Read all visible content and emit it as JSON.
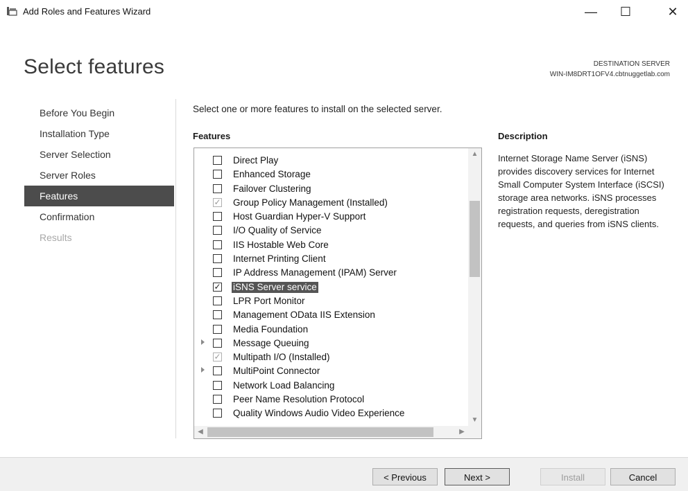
{
  "window": {
    "title": "Add Roles and Features Wizard",
    "controls": {
      "minimize": "—",
      "maximize": "☐",
      "close": "✕"
    }
  },
  "header": {
    "page_title": "Select features",
    "destination_label": "DESTINATION SERVER",
    "destination_server": "WIN-IM8DRT1OFV4.cbtnuggetlab.com"
  },
  "nav": {
    "items": [
      {
        "label": "Before You Begin",
        "state": "normal"
      },
      {
        "label": "Installation Type",
        "state": "normal"
      },
      {
        "label": "Server Selection",
        "state": "normal"
      },
      {
        "label": "Server Roles",
        "state": "normal"
      },
      {
        "label": "Features",
        "state": "active"
      },
      {
        "label": "Confirmation",
        "state": "normal"
      },
      {
        "label": "Results",
        "state": "disabled"
      }
    ]
  },
  "main": {
    "instruction": "Select one or more features to install on the selected server.",
    "features_heading": "Features",
    "features": [
      {
        "label": "Direct Play",
        "checked": false,
        "installed": false,
        "expandable": false,
        "selected": false
      },
      {
        "label": "Enhanced Storage",
        "checked": false,
        "installed": false,
        "expandable": false,
        "selected": false
      },
      {
        "label": "Failover Clustering",
        "checked": false,
        "installed": false,
        "expandable": false,
        "selected": false
      },
      {
        "label": "Group Policy Management (Installed)",
        "checked": true,
        "installed": true,
        "expandable": false,
        "selected": false
      },
      {
        "label": "Host Guardian Hyper-V Support",
        "checked": false,
        "installed": false,
        "expandable": false,
        "selected": false
      },
      {
        "label": "I/O Quality of Service",
        "checked": false,
        "installed": false,
        "expandable": false,
        "selected": false
      },
      {
        "label": "IIS Hostable Web Core",
        "checked": false,
        "installed": false,
        "expandable": false,
        "selected": false
      },
      {
        "label": "Internet Printing Client",
        "checked": false,
        "installed": false,
        "expandable": false,
        "selected": false
      },
      {
        "label": "IP Address Management (IPAM) Server",
        "checked": false,
        "installed": false,
        "expandable": false,
        "selected": false
      },
      {
        "label": "iSNS Server service",
        "checked": true,
        "installed": false,
        "expandable": false,
        "selected": true
      },
      {
        "label": "LPR Port Monitor",
        "checked": false,
        "installed": false,
        "expandable": false,
        "selected": false
      },
      {
        "label": "Management OData IIS Extension",
        "checked": false,
        "installed": false,
        "expandable": false,
        "selected": false
      },
      {
        "label": "Media Foundation",
        "checked": false,
        "installed": false,
        "expandable": false,
        "selected": false
      },
      {
        "label": "Message Queuing",
        "checked": false,
        "installed": false,
        "expandable": true,
        "selected": false
      },
      {
        "label": "Multipath I/O (Installed)",
        "checked": true,
        "installed": true,
        "expandable": false,
        "selected": false
      },
      {
        "label": "MultiPoint Connector",
        "checked": false,
        "installed": false,
        "expandable": true,
        "selected": false
      },
      {
        "label": "Network Load Balancing",
        "checked": false,
        "installed": false,
        "expandable": false,
        "selected": false
      },
      {
        "label": "Peer Name Resolution Protocol",
        "checked": false,
        "installed": false,
        "expandable": false,
        "selected": false
      },
      {
        "label": "Quality Windows Audio Video Experience",
        "checked": false,
        "installed": false,
        "expandable": false,
        "selected": false
      }
    ],
    "scroll_icons": {
      "up": "▲",
      "down": "▼",
      "left": "◀",
      "right": "▶"
    },
    "description_heading": "Description",
    "description_text": "Internet Storage Name Server (iSNS) provides discovery services for Internet Small Computer System Interface (iSCSI) storage area networks. iSNS processes registration requests, deregistration requests, and queries from iSNS clients."
  },
  "footer": {
    "previous_label": "< Previous",
    "next_label": "Next >",
    "install_label": "Install",
    "cancel_label": "Cancel"
  }
}
